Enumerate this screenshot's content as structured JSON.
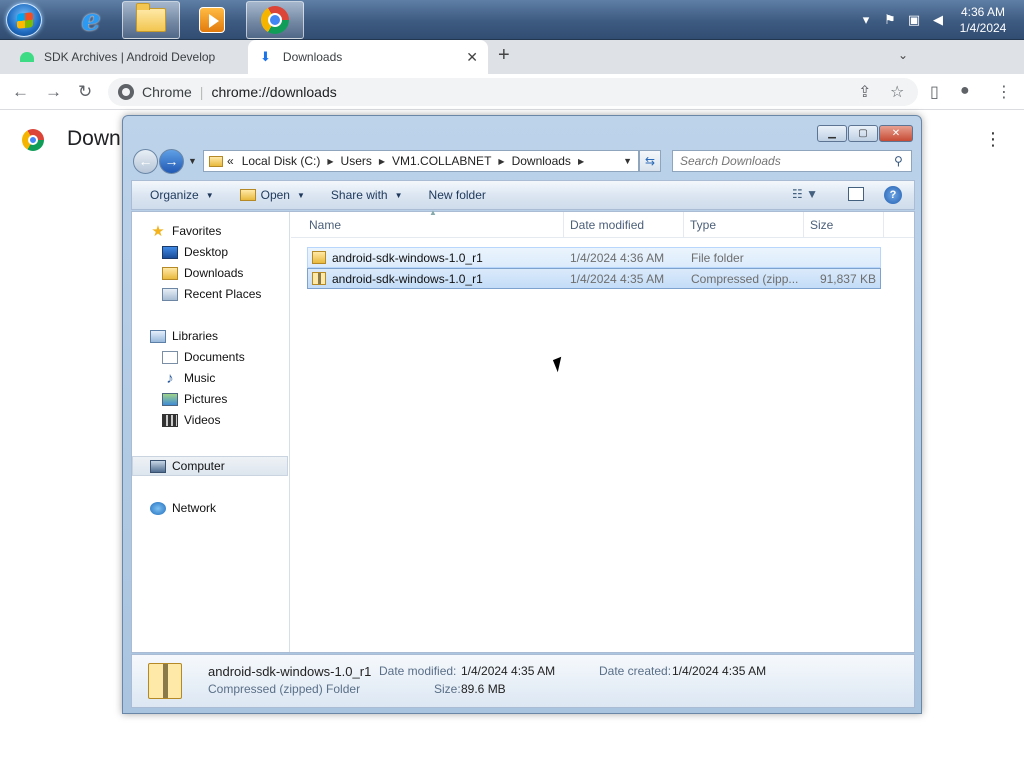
{
  "taskbar": {
    "apps": [
      {
        "name": "Internet Explorer"
      },
      {
        "name": "Windows Explorer"
      },
      {
        "name": "Windows Media Player"
      },
      {
        "name": "Google Chrome"
      }
    ],
    "clock": {
      "time": "4:36 AM",
      "date": "1/4/2024"
    }
  },
  "browser": {
    "tabs": [
      {
        "title": "SDK Archives  |  Android Develop",
        "active": false
      },
      {
        "title": "Downloads",
        "active": true
      }
    ],
    "new_tab": "+",
    "omnibox": {
      "site": "Chrome",
      "url": "chrome://downloads"
    },
    "page_title": "Downl"
  },
  "explorer": {
    "breadcrumb": [
      "Local Disk (C:)",
      "Users",
      "VM1.COLLABNET",
      "Downloads"
    ],
    "breadcrumb_prefix": "«",
    "search_placeholder": "Search Downloads",
    "commands": {
      "organize": "Organize",
      "open": "Open",
      "share": "Share with",
      "new_folder": "New folder"
    },
    "nav": {
      "favorites": "Favorites",
      "desktop": "Desktop",
      "downloads": "Downloads",
      "recent": "Recent Places",
      "libraries": "Libraries",
      "documents": "Documents",
      "music": "Music",
      "pictures": "Pictures",
      "videos": "Videos",
      "computer": "Computer",
      "network": "Network"
    },
    "columns": {
      "name": "Name",
      "date": "Date modified",
      "type": "Type",
      "size": "Size"
    },
    "files": [
      {
        "name": "android-sdk-windows-1.0_r1",
        "date": "1/4/2024 4:36 AM",
        "type": "File folder",
        "size": ""
      },
      {
        "name": "android-sdk-windows-1.0_r1",
        "date": "1/4/2024 4:35 AM",
        "type": "Compressed (zipp...",
        "size": "91,837 KB"
      }
    ],
    "details": {
      "name": "android-sdk-windows-1.0_r1",
      "kind": "Compressed (zipped) Folder",
      "modified_label": "Date modified:",
      "modified": "1/4/2024 4:35 AM",
      "created_label": "Date created:",
      "created": "1/4/2024 4:35 AM",
      "size_label": "Size:",
      "size": "89.6 MB"
    }
  }
}
